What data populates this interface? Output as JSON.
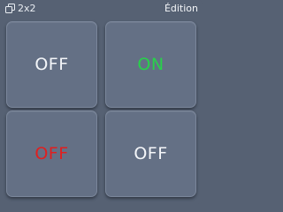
{
  "header": {
    "icon": "grid-copy-icon",
    "size_label": "2x2",
    "edit_label": "Édition"
  },
  "tiles": [
    {
      "label": "OFF",
      "color": "#f4f6f9"
    },
    {
      "label": "ON",
      "color": "#27d24a"
    },
    {
      "label": "OFF",
      "color": "#e01f1f"
    },
    {
      "label": "OFF",
      "color": "#f4f6f9"
    }
  ],
  "colors": {
    "background": "#566173",
    "tile_face": "#647085",
    "tile_border": "#7b879b"
  }
}
